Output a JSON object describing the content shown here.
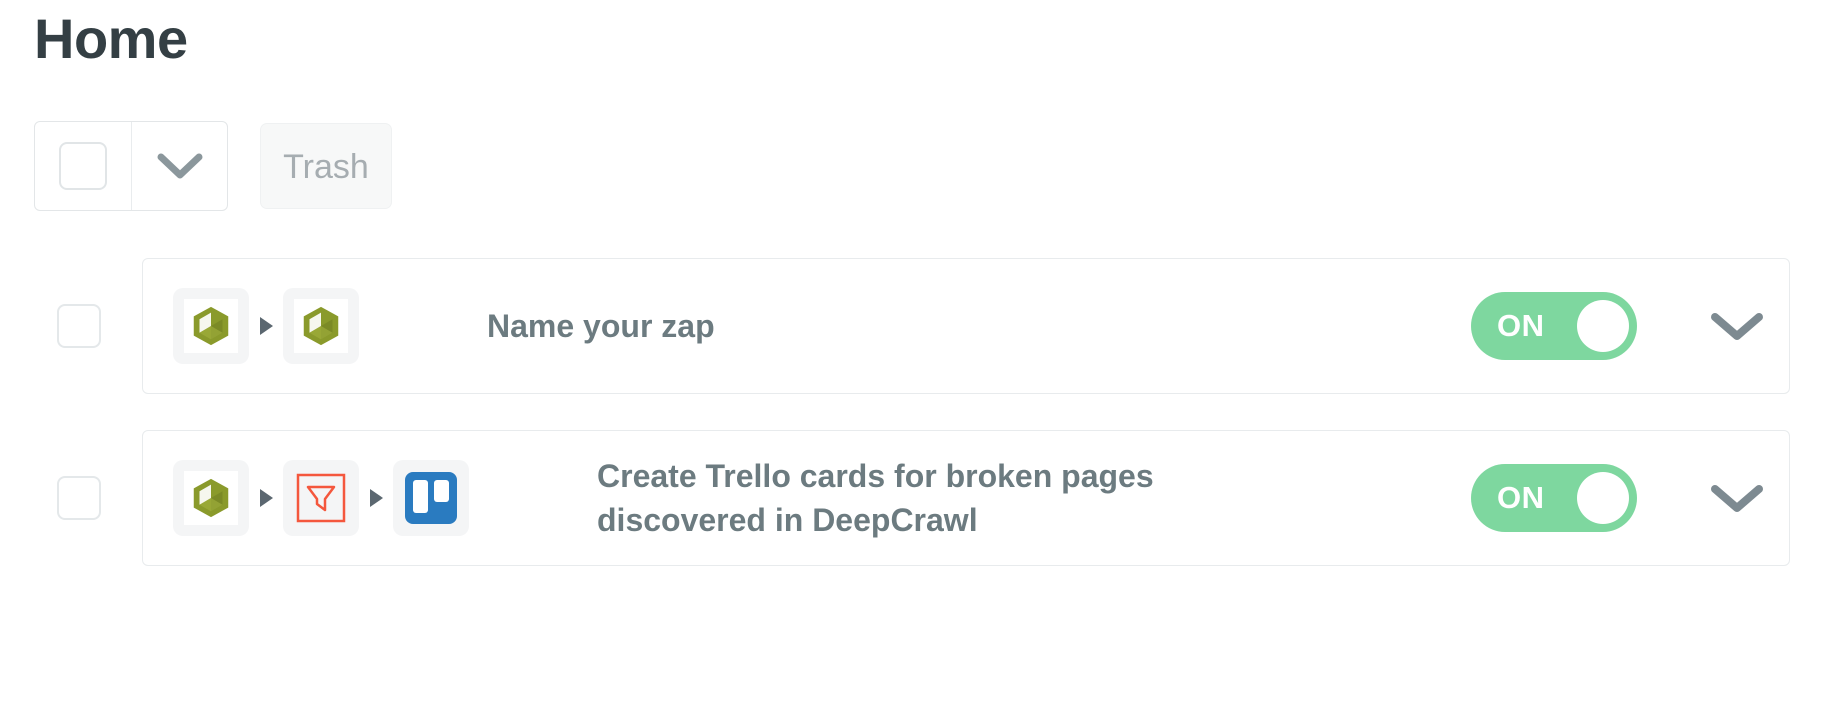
{
  "page": {
    "title": "Home",
    "background_color": "#ffffff",
    "title_color": "#343f44"
  },
  "toolbar": {
    "select_all": {
      "name": "select-all-checkbox",
      "checked": false
    },
    "select_all_dropdown": {
      "icon": "chevron-down-icon",
      "color": "#8b979c"
    },
    "trash_label": "Trash",
    "trash_enabled": false,
    "trash_text_color": "#a6adb1",
    "trash_background": "#f7f8f8"
  },
  "zaps": [
    {
      "checkbox_checked": false,
      "title": "Name your zap",
      "apps": [
        {
          "icon": "deepcrawl-cube-icon",
          "label": "DeepCrawl",
          "color": "#8a9a2b"
        },
        {
          "icon": "deepcrawl-cube-icon",
          "label": "DeepCrawl",
          "color": "#8a9a2b"
        }
      ],
      "toggle_label": "ON",
      "toggle_state": "on",
      "toggle_color": "#7ed79f",
      "expand_icon": "chevron-down-icon"
    },
    {
      "checkbox_checked": false,
      "title": "Create Trello cards for broken pages discovered in DeepCrawl",
      "apps": [
        {
          "icon": "deepcrawl-cube-icon",
          "label": "DeepCrawl",
          "color": "#8a9a2b"
        },
        {
          "icon": "filter-funnel-icon",
          "label": "Filter",
          "color": "#ff4f00"
        },
        {
          "icon": "trello-icon",
          "label": "Trello",
          "color": "#2a7bc0"
        }
      ],
      "toggle_label": "ON",
      "toggle_state": "on",
      "toggle_color": "#7ed79f",
      "expand_icon": "chevron-down-icon"
    }
  ]
}
